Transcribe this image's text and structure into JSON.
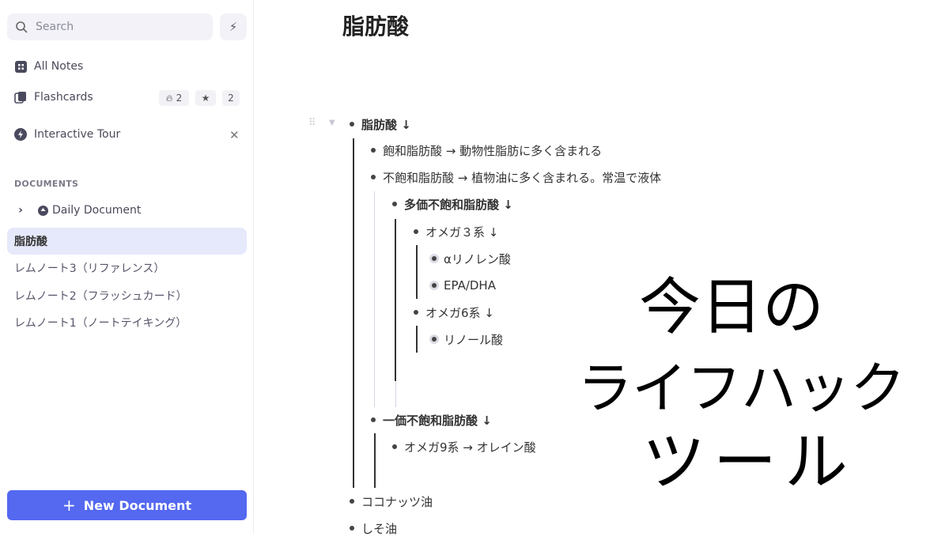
{
  "sidebar": {
    "search_placeholder": "Search",
    "all_notes": "All Notes",
    "flashcards": "Flashcards",
    "flash_due": "2",
    "flash_star": "2",
    "tour": "Interactive Tour",
    "section": "DOCUMENTS",
    "daily": "Daily Document",
    "docs": [
      "脂肪酸",
      "レムノート3（リファレンス）",
      "レムノート2（フラッシュカード）",
      "レムノート1（ノートテイキング）"
    ],
    "new_doc": "New Document",
    "accent": "#5468f0"
  },
  "doc": {
    "title": "脂肪酸",
    "rows": [
      {
        "level": 0,
        "text": "脂肪酸 ↓",
        "bold": true
      },
      {
        "level": 1,
        "text": "飽和脂肪酸 → 動物性脂肪に多く含まれる"
      },
      {
        "level": 1,
        "text": "不飽和脂肪酸 → 植物油に多く含まれる。常温で液体"
      },
      {
        "level": 2,
        "text": "多価不飽和脂肪酸 ↓",
        "bold": true
      },
      {
        "level": 3,
        "text": "オメガ３系 ↓"
      },
      {
        "level": 4,
        "text": "αリノレン酸",
        "ring": true
      },
      {
        "level": 4,
        "text": "EPA/DHA",
        "ring": true
      },
      {
        "level": 3,
        "text": "オメガ6系 ↓"
      },
      {
        "level": 4,
        "text": "リノール酸",
        "ring": true
      },
      {
        "level": 1,
        "text": "一価不飽和脂肪酸 ↓",
        "bold": true
      },
      {
        "level": 2,
        "text": "オメガ9系 → オレイン酸"
      },
      {
        "level": 0,
        "text": "ココナッツ油"
      },
      {
        "level": 0,
        "text": "しそ油"
      }
    ]
  },
  "overlay": {
    "lines": [
      "今日の",
      "ライフハック",
      "ツール"
    ]
  }
}
